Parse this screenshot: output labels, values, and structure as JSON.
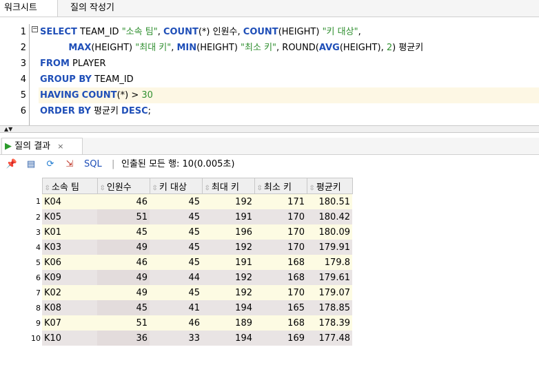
{
  "tabs": {
    "worksheet": "워크시트",
    "query_builder": "질의 작성기"
  },
  "editor": {
    "line_numbers": [
      "1",
      "2",
      "3",
      "4",
      "5",
      "6"
    ],
    "line1": {
      "kw1": "SELECT",
      "t1": " TEAM_ID ",
      "s1": "\"소속 팀\"",
      "t2": ", ",
      "kw2": "COUNT",
      "t3": "(*) 인원수, ",
      "kw3": "COUNT",
      "t4": "(HEIGHT) ",
      "s2": "\"키 대상\"",
      "t5": ","
    },
    "line2": {
      "indent": "          ",
      "kw1": "MAX",
      "t1": "(HEIGHT) ",
      "s1": "\"최대 키\"",
      "t2": ", ",
      "kw2": "MIN",
      "t3": "(HEIGHT) ",
      "s2": "\"최소 키\"",
      "t4": ", ROUND(",
      "kw3": "AVG",
      "t5": "(HEIGHT), ",
      "n1": "2",
      "t6": ") 평균키"
    },
    "line3": {
      "kw1": "FROM",
      "t1": " PLAYER"
    },
    "line4": {
      "kw1": "GROUP BY",
      "t1": " TEAM_ID"
    },
    "line5": {
      "kw1": "HAVING",
      "t1": " ",
      "kw2": "COUNT",
      "t2": "(*) > ",
      "n1": "30"
    },
    "line6": {
      "kw1": "ORDER BY",
      "t1": " 평균키 ",
      "kw2": "DESC",
      "t2": ";"
    }
  },
  "results_tab": {
    "label": "질의 결과",
    "close": "×"
  },
  "toolbar": {
    "sql_label": "SQL",
    "separator": "|",
    "status": "인출된 모든 행: 10(0.005초)"
  },
  "grid": {
    "columns": [
      "소속 팀",
      "인원수",
      "키 대상",
      "최대 키",
      "최소 키",
      "평균키"
    ],
    "rows": [
      {
        "n": "1",
        "team": "K04",
        "count": "46",
        "hcount": "45",
        "max": "192",
        "min": "171",
        "avg": "180.51"
      },
      {
        "n": "2",
        "team": "K05",
        "count": "51",
        "hcount": "45",
        "max": "191",
        "min": "170",
        "avg": "180.42"
      },
      {
        "n": "3",
        "team": "K01",
        "count": "45",
        "hcount": "45",
        "max": "196",
        "min": "170",
        "avg": "180.09"
      },
      {
        "n": "4",
        "team": "K03",
        "count": "49",
        "hcount": "45",
        "max": "192",
        "min": "170",
        "avg": "179.91"
      },
      {
        "n": "5",
        "team": "K06",
        "count": "46",
        "hcount": "45",
        "max": "191",
        "min": "168",
        "avg": "179.8"
      },
      {
        "n": "6",
        "team": "K09",
        "count": "49",
        "hcount": "44",
        "max": "192",
        "min": "168",
        "avg": "179.61"
      },
      {
        "n": "7",
        "team": "K02",
        "count": "49",
        "hcount": "45",
        "max": "192",
        "min": "170",
        "avg": "179.07"
      },
      {
        "n": "8",
        "team": "K08",
        "count": "45",
        "hcount": "41",
        "max": "194",
        "min": "165",
        "avg": "178.85"
      },
      {
        "n": "9",
        "team": "K07",
        "count": "51",
        "hcount": "46",
        "max": "189",
        "min": "168",
        "avg": "178.39"
      },
      {
        "n": "10",
        "team": "K10",
        "count": "36",
        "hcount": "33",
        "max": "194",
        "min": "169",
        "avg": "177.48"
      }
    ]
  },
  "icons": [
    "pin-icon",
    "print-icon",
    "refresh-icon",
    "export-icon",
    "sort-icon",
    "play-icon"
  ],
  "colors": {
    "keyword": "#1f4fb8",
    "string": "#2f8f2f",
    "row_light": "#fdfbe3",
    "row_dark": "#e9e4e4",
    "current_line": "#fdf7e4"
  }
}
